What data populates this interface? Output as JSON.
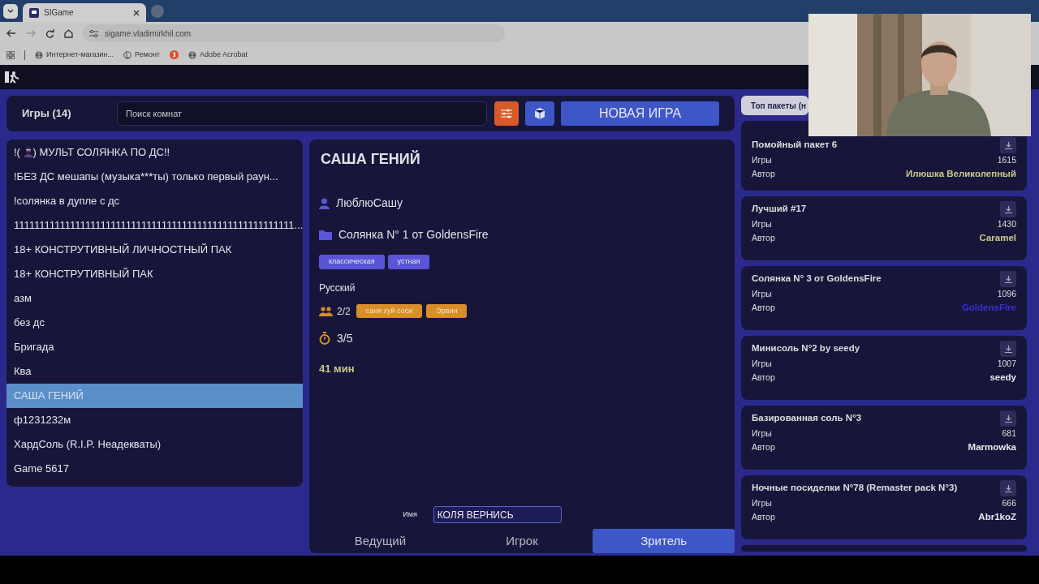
{
  "browser": {
    "tab_title": "SIGame",
    "url": "sigame.vladimirkhil.com",
    "bookmarks": [
      {
        "label": "Интернет-магазин...",
        "kind": "globe"
      },
      {
        "label": "Ремонт",
        "kind": "letter"
      },
      {
        "label": "Adobe Acrobat",
        "kind": "globe"
      }
    ]
  },
  "games_header": {
    "title": "Игры (14)",
    "search": {
      "placeholder": "Поиск комнат"
    },
    "new_game_button": "НОВАЯ ИГРА"
  },
  "rooms": [
    {
      "name": "!( ",
      "emoji": true,
      "name_after": ") МУЛЬТ СОЛЯНКА ПО ДС!!",
      "selected": false
    },
    {
      "name": "!БЕЗ ДС мешапы (музыка***ты) только первый раун...",
      "selected": false
    },
    {
      "name": "!солянка в дупле с дс",
      "selected": false
    },
    {
      "name": "1111111111111111111111111111111111111111111111111111111...",
      "selected": false
    },
    {
      "name": "18+ КОНСТРУТИВНЫЙ ЛИЧНОСТНЫЙ ПАК",
      "selected": false
    },
    {
      "name": "18+ КОНСТРУТИВНЫЙ ПАК",
      "selected": false
    },
    {
      "name": "азм",
      "selected": false
    },
    {
      "name": "без дс",
      "selected": false
    },
    {
      "name": "Бригада",
      "selected": false
    },
    {
      "name": "Ква",
      "selected": false
    },
    {
      "name": "САША ГЕНИЙ",
      "selected": true
    },
    {
      "name": "ф1231232м",
      "selected": false
    },
    {
      "name": "ХардСоль (R.I.P. Неадекваты)",
      "selected": false
    },
    {
      "name": "Game 5617",
      "selected": false
    }
  ],
  "room_detail": {
    "title": "САША ГЕНИЙ",
    "host": "ЛюблюСашу",
    "package": "Солянка N° 1 от GoldensFire",
    "tags": [
      "классическая",
      "устная"
    ],
    "language": "Русский",
    "players_count": "2/2",
    "players": [
      "саня хуй соси",
      "Эрвин"
    ],
    "round": "3/5",
    "time": "41 мин",
    "name_label": "Имя",
    "name_value": "КОЛЯ ВЕРНИСЬ",
    "roles": [
      {
        "label": "Ведущий",
        "selected": false
      },
      {
        "label": "Игрок",
        "selected": false
      },
      {
        "label": "Зритель",
        "selected": true
      }
    ]
  },
  "top_packages": {
    "tab_label": "Топ пакеты (н",
    "packages": [
      {
        "title": "Помойный пакет 6",
        "games_label": "Игры",
        "games": "1615",
        "author_label": "Автор",
        "author": "Илюшка Великолепный",
        "color": "#c9c98a"
      },
      {
        "title": "Лучший #17",
        "games_label": "Игры",
        "games": "1430",
        "author_label": "Автор",
        "author": "Caramel",
        "color": "#c9c98a"
      },
      {
        "title": "Солянка N° 3 от GoldensFire",
        "games_label": "Игры",
        "games": "1096",
        "author_label": "Автор",
        "author": "GoldensFire",
        "color": "#3a2fd6"
      },
      {
        "title": "Минисоль N°2 by seedy",
        "games_label": "Игры",
        "games": "1007",
        "author_label": "Автор",
        "author": "seedy",
        "color": "#e8e8ee"
      },
      {
        "title": "Базированная соль N°3",
        "games_label": "Игры",
        "games": "681",
        "author_label": "Автор",
        "author": "Marmowka",
        "color": "#e8e8ee"
      },
      {
        "title": "Ночные посиделки N°78 (Remaster pack N°3)",
        "games_label": "Игры",
        "games": "666",
        "author_label": "Автор",
        "author": "Abr1koZ",
        "color": "#e8e8ee"
      }
    ]
  }
}
